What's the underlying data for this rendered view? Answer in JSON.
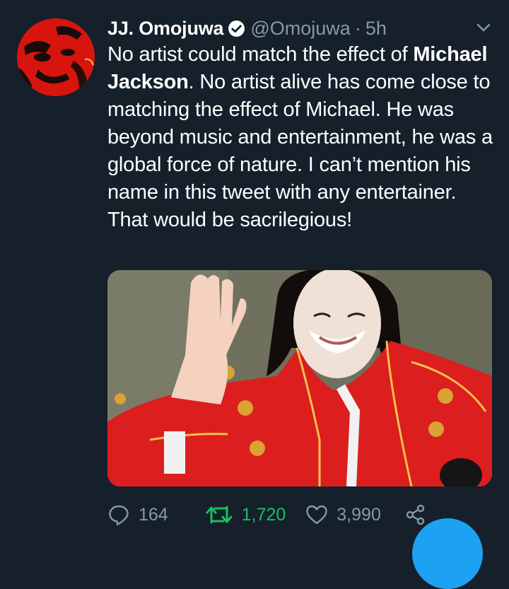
{
  "tweet": {
    "author_name": "JJ. Omojuwa",
    "handle": "@Omojuwa",
    "separator": "·",
    "time": "5h",
    "text_before": "No artist could match the effect of ",
    "text_bold": "Michael Jackson",
    "text_after": ". No artist alive has come close to matching the effect of Michael. He was beyond music and entertainment, he was a global force of nature. I can’t mention his name in this tweet with any entertainer. That would be sacrilegious!"
  },
  "stats": {
    "replies": "164",
    "retweets": "1,720",
    "likes": "3,990"
  },
  "colors": {
    "background": "#15202b",
    "secondary_text": "#8899a6",
    "retweet_active": "#17bf63",
    "accent": "#1da1f2"
  },
  "icons": {
    "verified": "verified-badge-icon",
    "more": "chevron-down-icon",
    "reply": "reply-bubble-icon",
    "retweet": "retweet-icon",
    "like": "heart-icon",
    "share": "share-icon"
  }
}
